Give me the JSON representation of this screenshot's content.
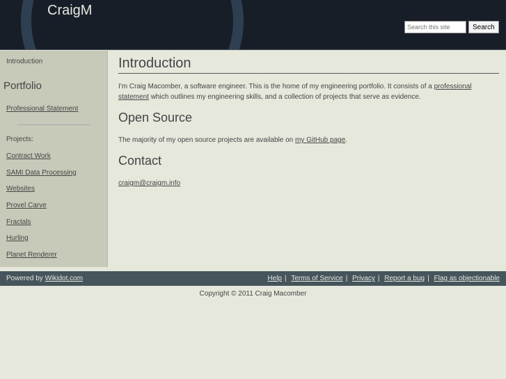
{
  "header": {
    "title": "CraigM",
    "search_placeholder": "Search this site",
    "search_button": "Search"
  },
  "sidebar": {
    "introduction": "Introduction",
    "portfolio_heading": "Portfolio",
    "professional_statement": "Professional Statement",
    "projects_label": "Projects:",
    "projects": [
      "Contract Work",
      "SAMI Data Processing",
      "Websites",
      "Provel Carve",
      "Fractals",
      "Hurling",
      "Planet Renderer"
    ]
  },
  "main": {
    "intro_heading": "Introduction",
    "intro_text_1": "I'm Craig Macomber, a software engineer. This is the home of my engineering portfolio. It consists of a ",
    "intro_link": "professional statement",
    "intro_text_2": " which outlines my engineering skills, and a collection of projects that serve as evidence.",
    "os_heading": "Open Source",
    "os_text": "The majority of my open source projects are available on ",
    "os_link": "my GitHub page",
    "os_end": ".",
    "contact_heading": "Contact",
    "contact_email": "craigm@craigm.info"
  },
  "footer": {
    "powered_by": "Powered by ",
    "wikidot": "Wikidot.com",
    "links": [
      "Help",
      "Terms of Service",
      "Privacy",
      "Report a bug",
      "Flag as objectionable"
    ],
    "copyright": "Copyright © 2011 Craig Macomber"
  }
}
